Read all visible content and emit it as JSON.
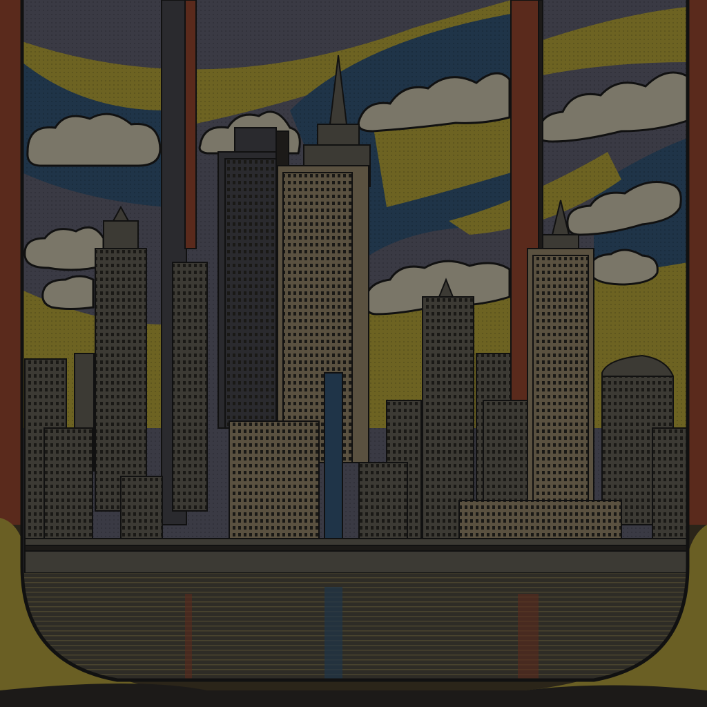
{
  "colors": {
    "sky_blue": "#1f3448",
    "sky_gray": "#3a3a44",
    "sky_yellow": "#6d6322",
    "ochre": "#6a5f24",
    "ochre_light": "#857827",
    "cloud": "#7a7668",
    "cloud_shadow": "#5b584f",
    "building_dark": "#2a2a2e",
    "building_mid": "#3c3a34",
    "building_light": "#5a5140",
    "window": "#1a1916",
    "frame_red": "#5a2a1c",
    "frame_dark": "#1c1a18",
    "water": "#2e2c26",
    "water_line": "#4a442f",
    "outline": "#111111"
  }
}
